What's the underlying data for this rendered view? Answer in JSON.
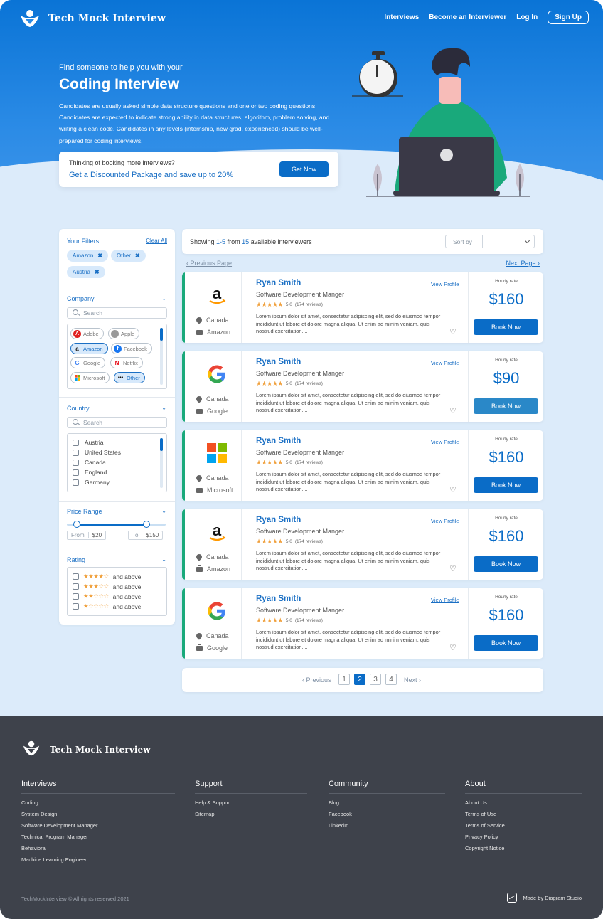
{
  "brand": {
    "name": "Tech Mock Interview"
  },
  "nav": {
    "interviews": "Interviews",
    "become": "Become an Interviewer",
    "login": "Log In",
    "signup": "Sign Up"
  },
  "hero": {
    "kicker": "Find someone to help you with your",
    "title": "Coding Interview",
    "description": "Candidates are usually asked simple data structure questions and one or two coding questions. Candidates are expected to indicate strong ability in data structures, algorithm, problem solving, and writing a clean code. Candidates in any levels (internship, new grad, experienced) should be well-prepared for coding interviews.",
    "promo_question": "Thinking of booking more interviews?",
    "promo_offer": "Get a Discounted Package and save up to 20%",
    "promo_button": "Get Now"
  },
  "filters": {
    "title": "Your Filters",
    "clear": "Clear All",
    "active": [
      "Amazon",
      "Other",
      "Austria"
    ],
    "company": {
      "title": "Company",
      "search_placeholder": "Search",
      "options": [
        "Adobe",
        "Apple",
        "Amazon",
        "Facebook",
        "Google",
        "Netflix",
        "Microsoft",
        "Other"
      ]
    },
    "country": {
      "title": "Country",
      "search_placeholder": "Search",
      "options": [
        "Austria",
        "United States",
        "Canada",
        "England",
        "Germany"
      ]
    },
    "price": {
      "title": "Price Range",
      "from_label": "From",
      "from_value": "$20",
      "to_label": "To",
      "to_value": "$150",
      "min": 20,
      "max": 150
    },
    "rating": {
      "title": "Rating",
      "options": [
        {
          "stars": 4,
          "label": "and above"
        },
        {
          "stars": 3,
          "label": "and above"
        },
        {
          "stars": 2,
          "label": "and above"
        },
        {
          "stars": 1,
          "label": "and above"
        }
      ]
    }
  },
  "results": {
    "showing_prefix": "Showing",
    "range": "1-5",
    "from": "from",
    "total": "15",
    "suffix": "available interviewers",
    "sort_label": "Sort by",
    "prev_page": "Previous Page",
    "next_page": "Next Page"
  },
  "cards": [
    {
      "name": "Ryan Smith",
      "role": "Software Development Manger",
      "rating": "5.0",
      "reviews": "(174 reviews)",
      "country": "Canada",
      "company": "Amazon",
      "logo": "amazon-logo",
      "price": "$160",
      "hourly": "Hourly rate",
      "view": "View Profile",
      "book": "Book Now",
      "desc": "Lorem ipsum dolor sit amet, consectetur adipiscing elit, sed do eiusmod tempor incididunt ut labore et dolore magna aliqua. Ut enim ad minim veniam, quis nostrud exercitation...."
    },
    {
      "name": "Ryan Smith",
      "role": "Software Development Manger",
      "rating": "5.0",
      "reviews": "(174 reviews)",
      "country": "Canada",
      "company": "Google",
      "logo": "google-logo",
      "price": "$90",
      "hourly": "Hourly rate",
      "view": "View Profile",
      "book": "Book Now",
      "desc": "Lorem ipsum dolor sit amet, consectetur adipiscing elit, sed do eiusmod tempor incididunt ut labore et dolore magna aliqua. Ut enim ad minim veniam, quis nostrud exercitation...."
    },
    {
      "name": "Ryan Smith",
      "role": "Software Development Manger",
      "rating": "5.0",
      "reviews": "(174 reviews)",
      "country": "Canada",
      "company": "Microsoft",
      "logo": "microsoft-logo",
      "price": "$160",
      "hourly": "Hourly rate",
      "view": "View Profile",
      "book": "Book Now",
      "desc": "Lorem ipsum dolor sit amet, consectetur adipiscing elit, sed do eiusmod tempor incididunt ut labore et dolore magna aliqua. Ut enim ad minim veniam, quis nostrud exercitation...."
    },
    {
      "name": "Ryan Smith",
      "role": "Software Development Manger",
      "rating": "5.0",
      "reviews": "(174 reviews)",
      "country": "Canada",
      "company": "Amazon",
      "logo": "amazon-logo",
      "price": "$160",
      "hourly": "Hourly rate",
      "view": "View Profile",
      "book": "Book Now",
      "desc": "Lorem ipsum dolor sit amet, consectetur adipiscing elit, sed do eiusmod tempor incididunt ut labore et dolore magna aliqua. Ut enim ad minim veniam, quis nostrud exercitation...."
    },
    {
      "name": "Ryan Smith",
      "role": "Software Development Manger",
      "rating": "5.0",
      "reviews": "(174 reviews)",
      "country": "Canada",
      "company": "Google",
      "logo": "google-logo",
      "price": "$160",
      "hourly": "Hourly rate",
      "view": "View Profile",
      "book": "Book Now",
      "desc": "Lorem ipsum dolor sit amet, consectetur adipiscing elit, sed do eiusmod tempor incididunt ut labore et dolore magna aliqua. Ut enim ad minim veniam, quis nostrud exercitation...."
    }
  ],
  "pagination": {
    "prev": "Previous",
    "next": "Next",
    "pages": [
      "1",
      "2",
      "3",
      "4"
    ],
    "current": "2"
  },
  "footer": {
    "columns": [
      {
        "title": "Interviews",
        "items": [
          "Coding",
          "System Design",
          "Software Development Manager",
          "Technical Program Manager",
          "Behavioral",
          "Machine Learning Engineer"
        ]
      },
      {
        "title": "Support",
        "items": [
          "Help & Support",
          "Sitemap"
        ]
      },
      {
        "title": "Community",
        "items": [
          "Blog",
          "Facebook",
          "LinkedIn"
        ]
      },
      {
        "title": "About",
        "items": [
          "About Us",
          "Terms of Use",
          "Terms of Service",
          "Privacy Policy",
          "Copyright Notice"
        ]
      }
    ],
    "copyright": "TechMockInterview © All rights reserved 2021",
    "made_by": "Made by Diagram Studio"
  },
  "colors": {
    "primary": "#0a6cc7",
    "accent_green": "#19a97b",
    "footer_bg": "#3e424b",
    "page_bg": "#dcebfa"
  }
}
